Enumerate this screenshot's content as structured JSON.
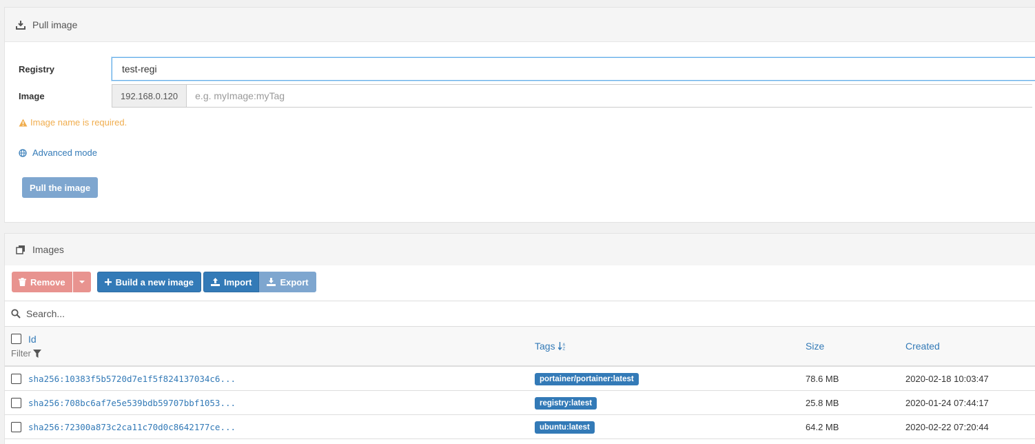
{
  "pull": {
    "title": "Pull image",
    "icon": "download-icon",
    "registry_label": "Registry",
    "registry_value": "test-regi",
    "image_label": "Image",
    "image_prefix": "192.168.0.120",
    "image_placeholder": "e.g. myImage:myTag",
    "warning": "Image name is required.",
    "advanced_mode": "Advanced mode",
    "pull_button": "Pull the image"
  },
  "images": {
    "title": "Images",
    "icon": "clone-icon",
    "toolbar": {
      "remove": "Remove",
      "build": "Build a new image",
      "import": "Import",
      "export": "Export"
    },
    "search_placeholder": "Search...",
    "columns": {
      "id": "Id",
      "filter": "Filter",
      "tags": "Tags",
      "size": "Size",
      "created": "Created"
    },
    "rows": [
      {
        "id": "sha256:10383f5b5720d7e1f5f824137034c6...",
        "tag": "portainer/portainer:latest",
        "size": "78.6 MB",
        "created": "2020-02-18 10:03:47"
      },
      {
        "id": "sha256:708bc6af7e5e539bdb59707bbf1053...",
        "tag": "registry:latest",
        "size": "25.8 MB",
        "created": "2020-01-24 07:44:17"
      },
      {
        "id": "sha256:72300a873c2ca11c70d0c8642177ce...",
        "tag": "ubuntu:latest",
        "size": "64.2 MB",
        "created": "2020-02-22 07:20:44"
      }
    ]
  },
  "colors": {
    "primary": "#337ab7",
    "warning": "#f0ad4e",
    "danger_disabled": "#e8938f"
  }
}
